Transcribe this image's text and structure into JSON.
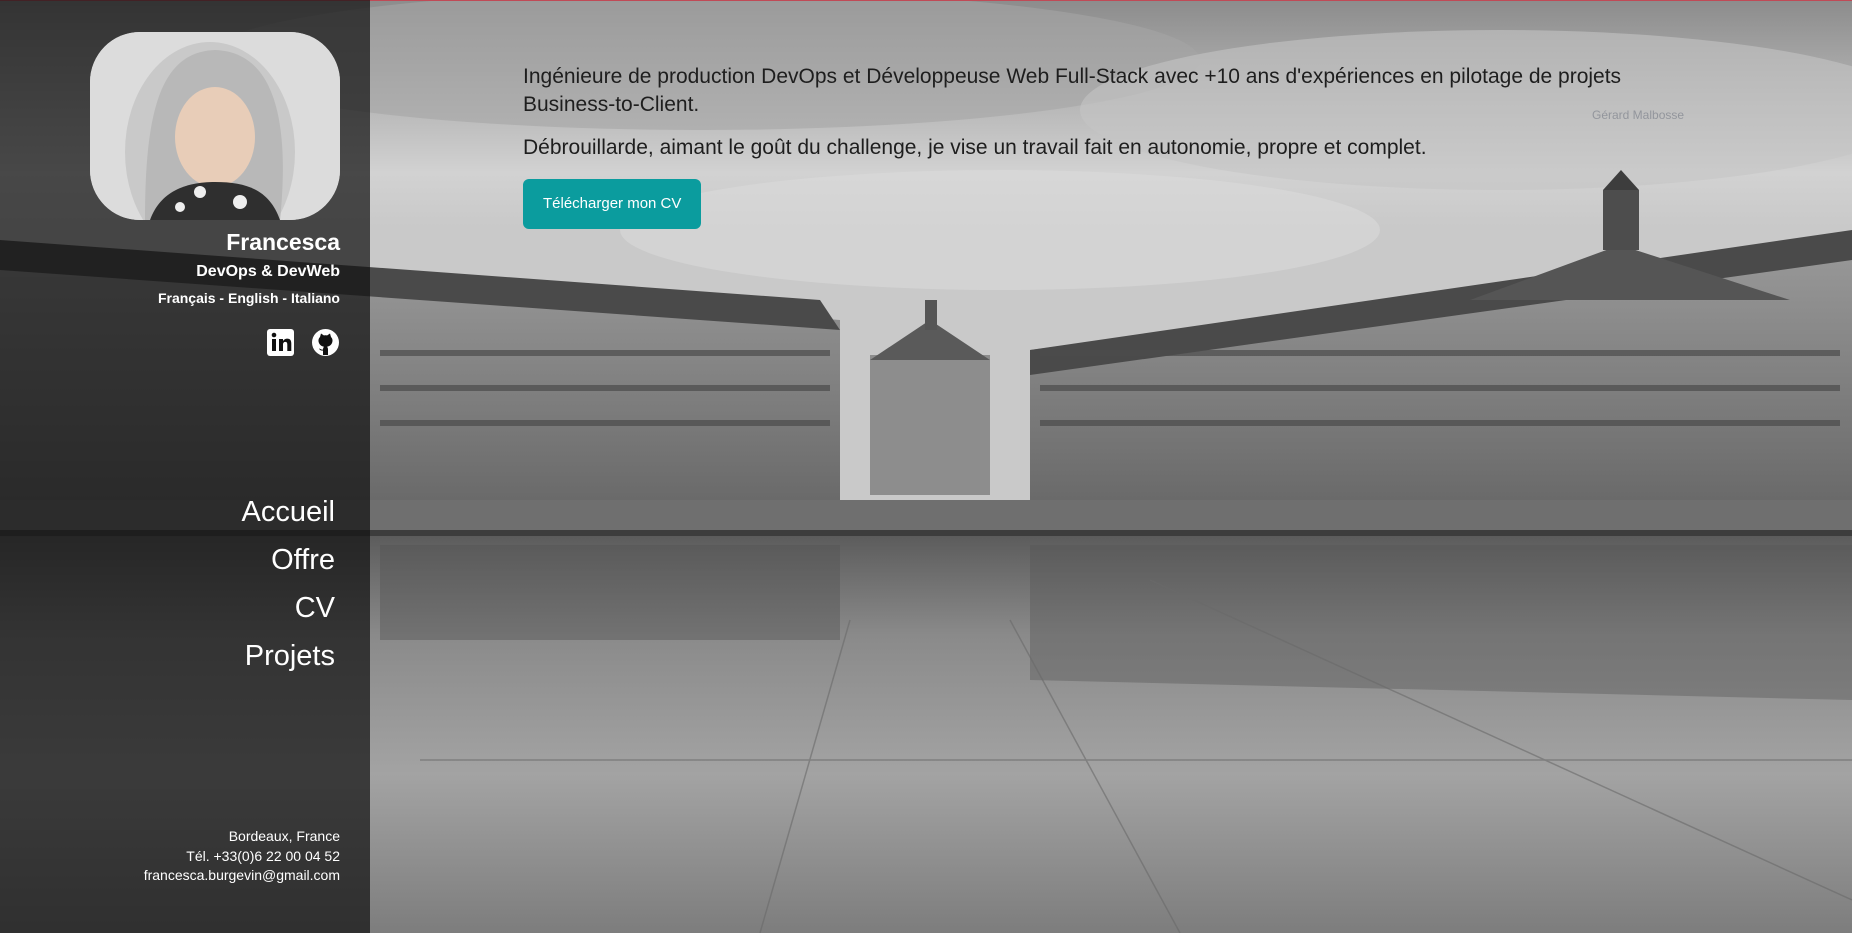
{
  "profile": {
    "name": "Francesca",
    "role": "DevOps & DevWeb",
    "languages": "Français - English - Italiano"
  },
  "social": [
    {
      "icon": "linkedin-icon",
      "label": "LinkedIn"
    },
    {
      "icon": "github-icon",
      "label": "GitHub"
    }
  ],
  "nav": {
    "items": [
      "Accueil",
      "Offre",
      "CV",
      "Projets"
    ]
  },
  "contact": {
    "city": "Bordeaux, France",
    "phone": "Tél. +33(0)6 22 00 04 52",
    "email": "francesca.burgevin@gmail.com"
  },
  "intro": {
    "paragraph1": "Ingénieure de production DevOps et Développeuse Web Full-Stack avec +10 ans d'expériences en pilotage de projets Business-to-Client.",
    "paragraph2": "Débrouillarde, aimant le goût du challenge, je vise un travail fait en autonomie, propre et complet.",
    "cv_button": "Télécharger mon CV"
  },
  "photo_credit": "Gérard Malbosse",
  "colors": {
    "accent": "#0b9c9e",
    "sidebar": "#121212"
  }
}
